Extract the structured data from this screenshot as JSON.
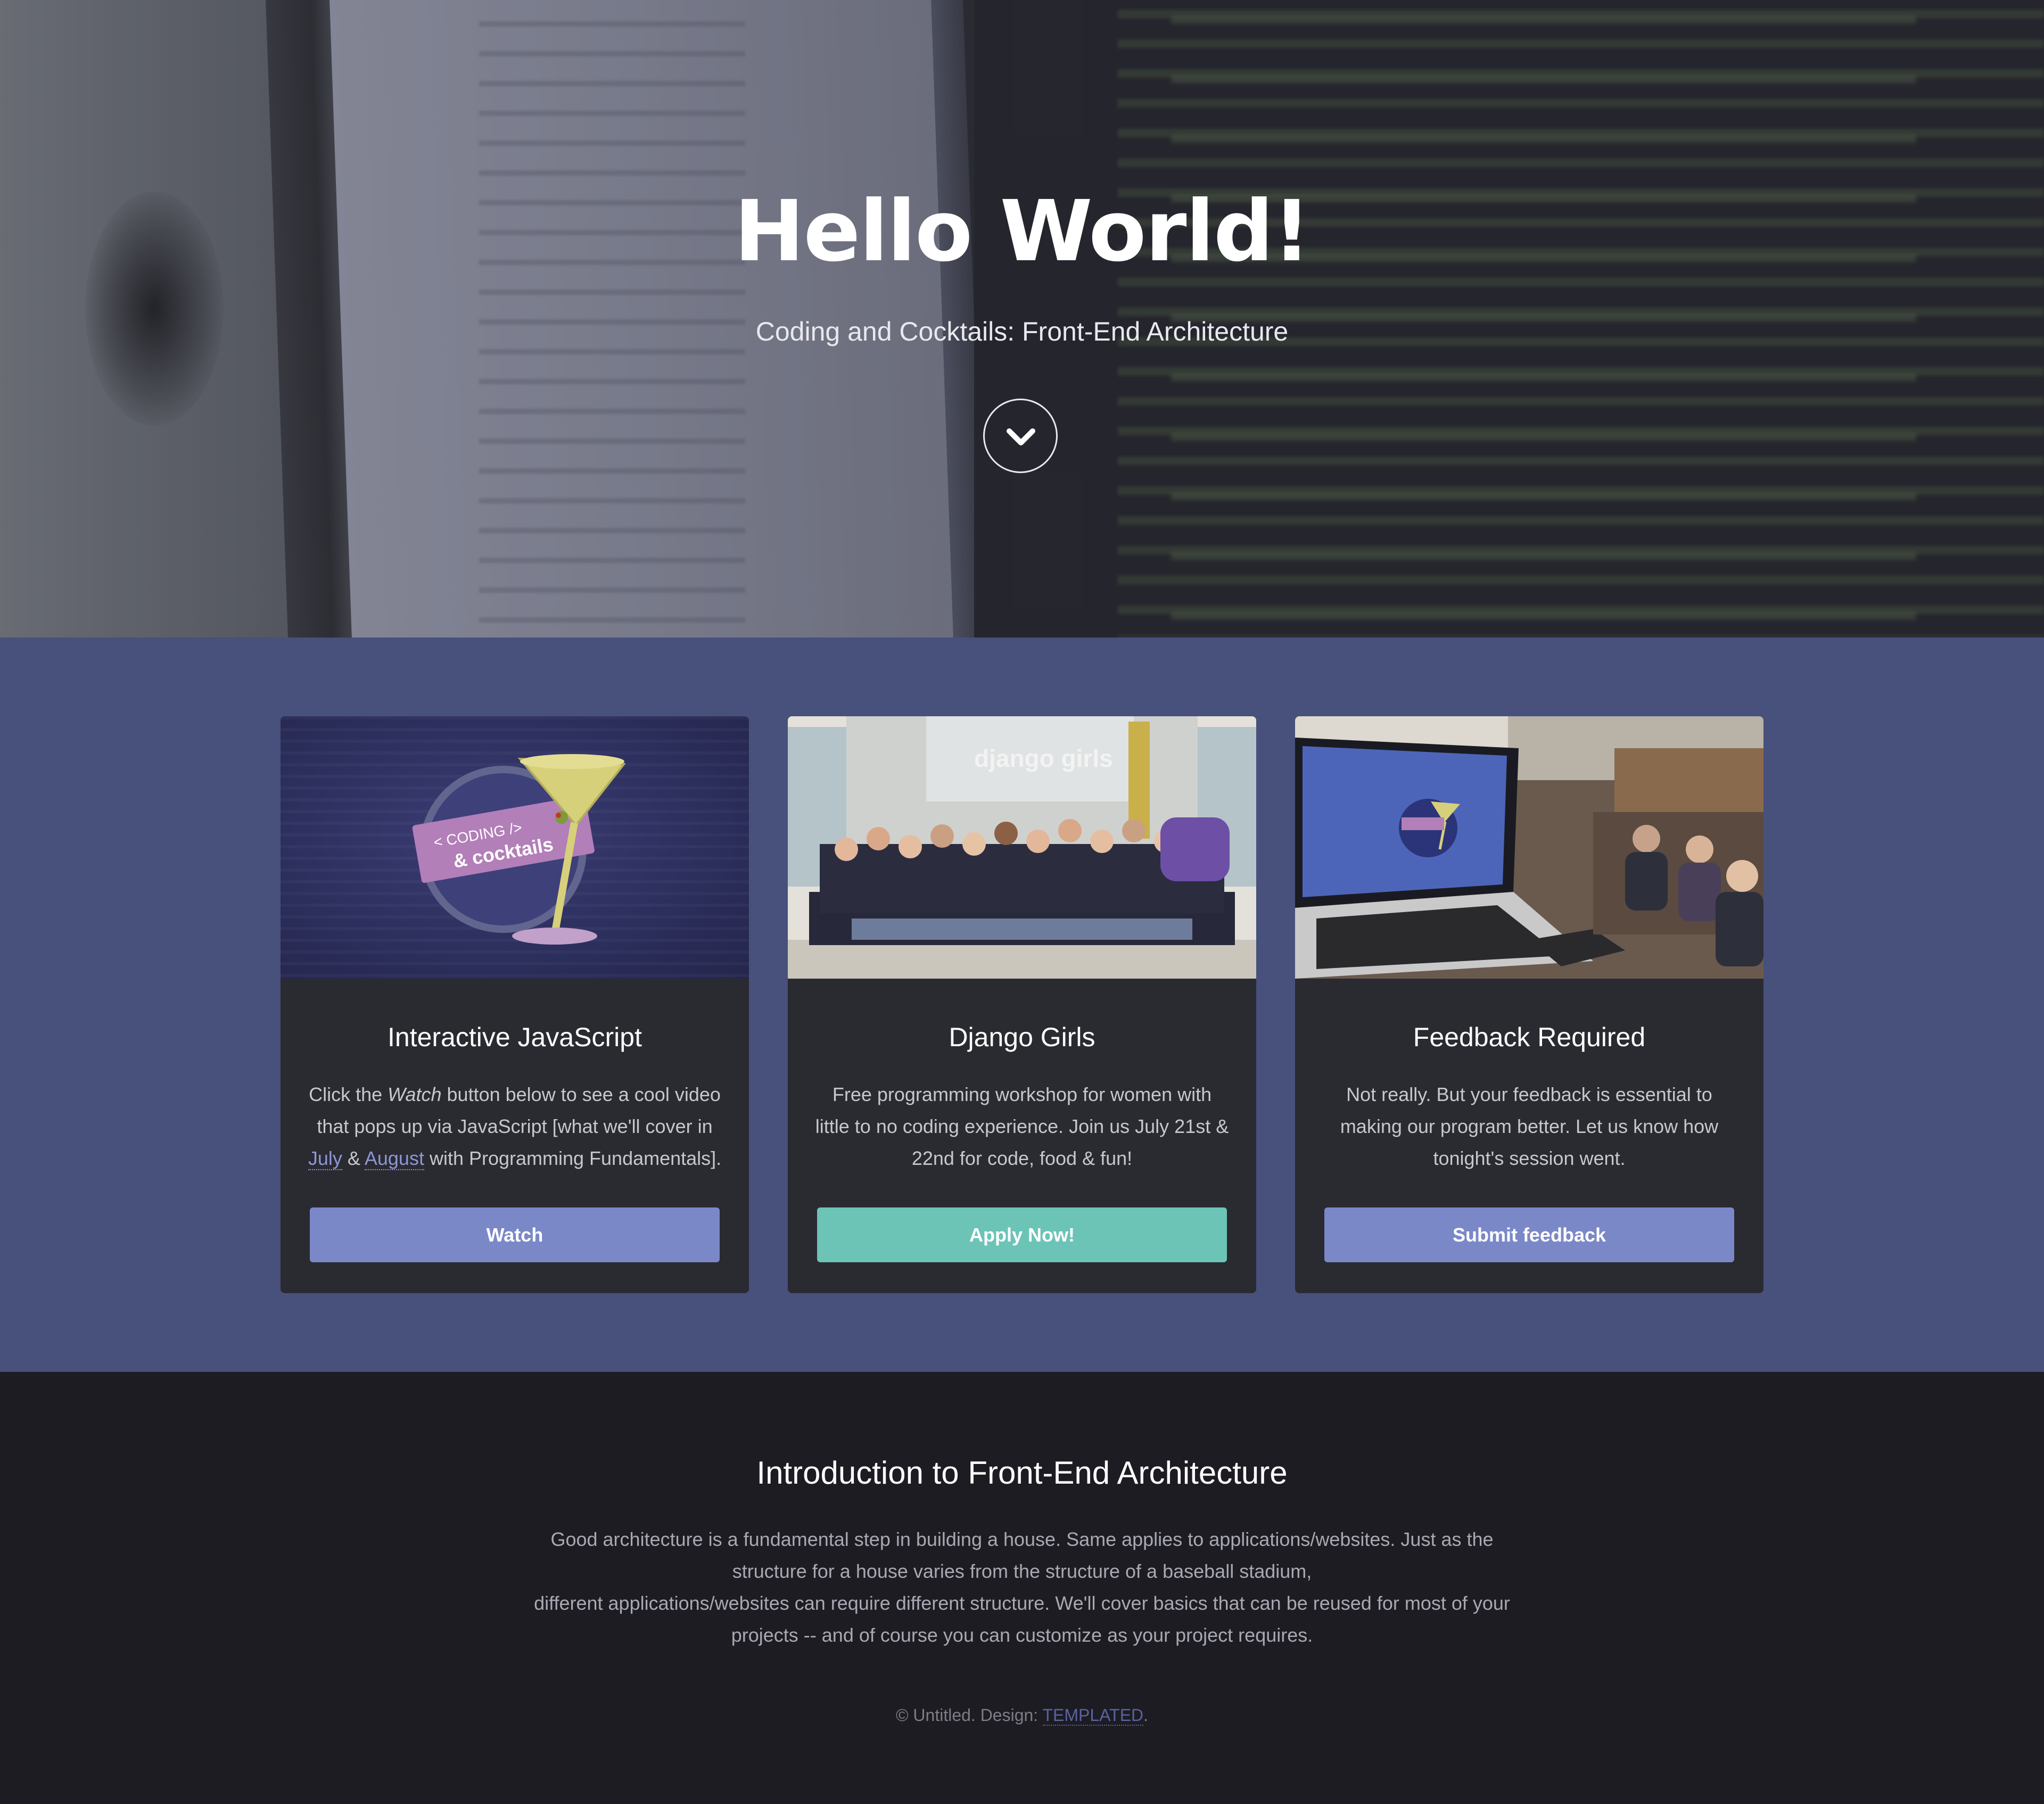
{
  "hero": {
    "title": "Hello World!",
    "subtitle": "Coding and Cocktails: Front-End Architecture",
    "scroll_icon": "chevron-down-icon"
  },
  "cards": [
    {
      "title": "Interactive JavaScript",
      "text_before": "Click the ",
      "text_em": "Watch",
      "text_mid": " button below to see a cool video that pops up via JavaScript [what we'll cover in ",
      "link_1": "July",
      "text_and": " & ",
      "link_2": "August",
      "text_after": " with Programming Fundamentals].",
      "button": "Watch",
      "image_logo_line1": "< CODING />",
      "image_logo_line2": "& cocktails"
    },
    {
      "title": "Django Girls",
      "text": "Free programming workshop for women with little to no coding experience. Join us July 21st & 22nd for code, food & fun!",
      "button": "Apply Now!",
      "image_sign": "django girls"
    },
    {
      "title": "Feedback Required",
      "text": "Not really. But your feedback is essential to making our program better. Let us know how tonight's session went.",
      "button": "Submit feedback"
    }
  ],
  "intro": {
    "title": "Introduction to Front-End Architecture",
    "line1": "Good architecture is a fundamental step in building a house. Same applies to applications/websites. Just as the structure for a house varies from the structure of a baseball stadium,",
    "line2": "different applications/websites can require different structure. We'll cover basics that can be reused for most of your projects -- and of course you can customize as your project requires."
  },
  "footer": {
    "prefix": "© Untitled. Design: ",
    "link": "TEMPLATED",
    "suffix": "."
  },
  "colors": {
    "hero_overlay": "#282834",
    "features_bg": "#48507c",
    "card_bg": "#2a2a31",
    "button_blue": "#7b88c8",
    "button_teal": "#6cc4b7",
    "intro_bg": "#1c1c22",
    "link": "#8d97d6"
  }
}
